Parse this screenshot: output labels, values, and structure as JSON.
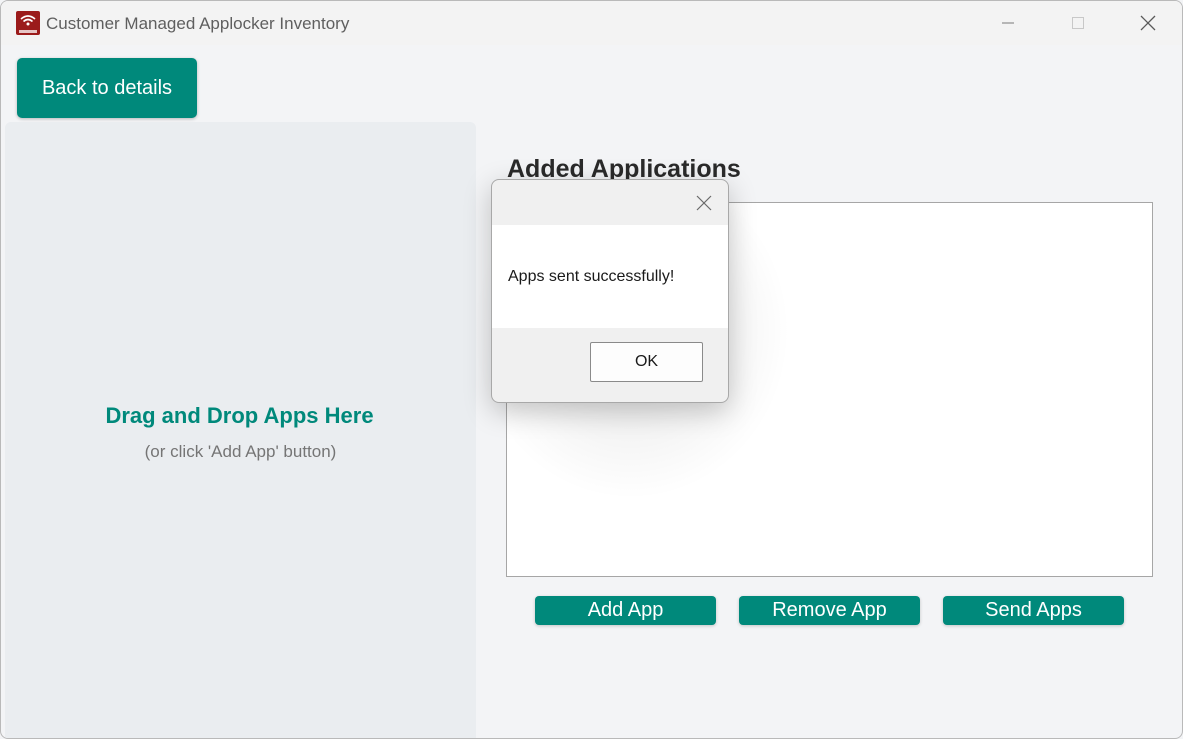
{
  "window": {
    "title": "Customer Managed Applocker Inventory",
    "icon": "app-logo-icon",
    "controls": [
      "minimize-icon",
      "maximize-icon",
      "close-icon"
    ]
  },
  "toolbar": {
    "back_label": "Back to details"
  },
  "drop_zone": {
    "title": "Drag and Drop Apps Here",
    "subtitle": "(or click 'Add App' button)"
  },
  "applications": {
    "heading": "Added Applications",
    "items": []
  },
  "actions": {
    "add_label": "Add App",
    "remove_label": "Remove App",
    "send_label": "Send Apps"
  },
  "dialog": {
    "message": "Apps sent successfully!",
    "ok_label": "OK"
  },
  "colors": {
    "accent": "#00897b",
    "app_icon": "#9b1b1b",
    "background": "#f3f4f6",
    "drop_zone": "#eaedf0"
  }
}
